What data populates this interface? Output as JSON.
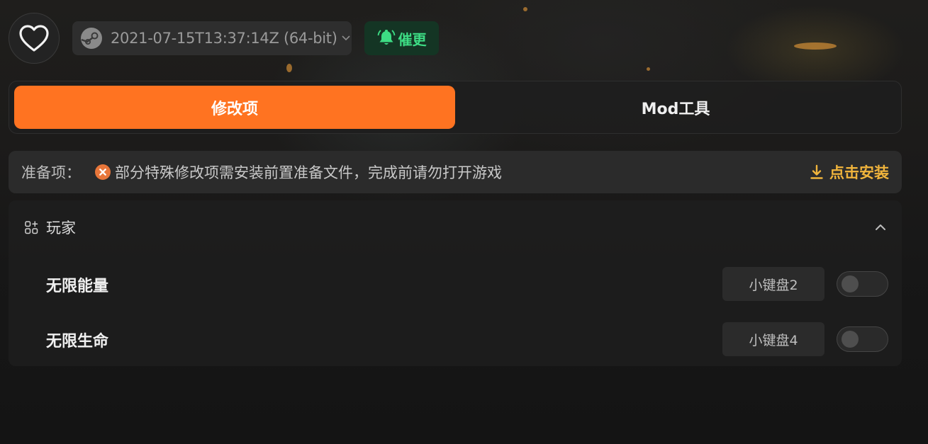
{
  "header": {
    "favorite_icon": "heart-icon",
    "version": {
      "platform_icon": "steam-icon",
      "label": "2021-07-15T13:37:14Z (64-bit)"
    },
    "remind_button": {
      "icon": "bell-icon",
      "label": "催更"
    }
  },
  "tabs": [
    {
      "label": "修改项",
      "active": true
    },
    {
      "label": "Mod工具",
      "active": false
    }
  ],
  "prep": {
    "title": "准备项：",
    "status_icon": "error-circle-icon",
    "message": "部分特殊修改项需安装前置准备文件，完成前请勿打开游戏",
    "install": {
      "icon": "download-icon",
      "label": "点击安装"
    }
  },
  "section": {
    "icon": "category-grid-icon",
    "title": "玩家",
    "expanded": true,
    "items": [
      {
        "name": "无限能量",
        "hotkey": "小键盘2",
        "enabled": false
      },
      {
        "name": "无限生命",
        "hotkey": "小键盘4",
        "enabled": false
      }
    ]
  },
  "colors": {
    "accent": "#ff7321",
    "remind_green": "#3ddc84",
    "install_gold": "#f0b43c",
    "error_orange": "#e8763a"
  }
}
